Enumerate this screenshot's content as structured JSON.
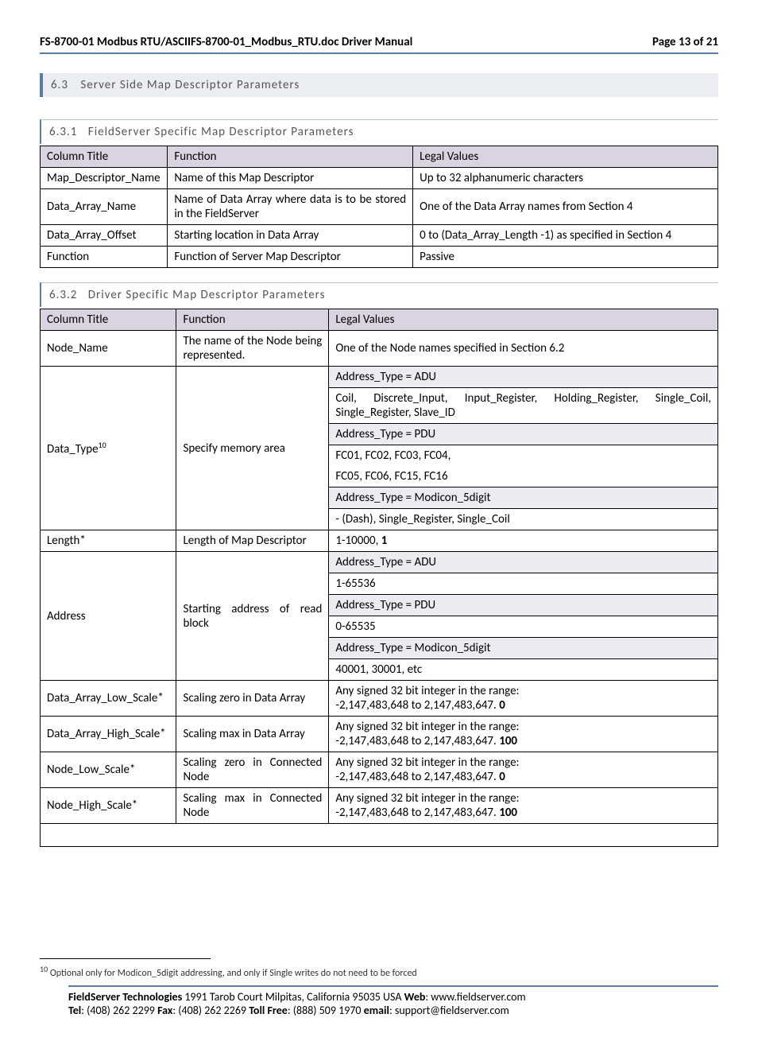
{
  "header": {
    "left": "FS-8700-01 Modbus RTU/ASCIIFS-8700-01_Modbus_RTU.doc Driver Manual",
    "right": "Page 13 of 21"
  },
  "section_6_3": {
    "num": "6.3",
    "title": "Server Side Map Descriptor Parameters"
  },
  "section_6_3_1": {
    "num": "6.3.1",
    "title": "FieldServer Specific Map Descriptor Parameters"
  },
  "table1_headers": {
    "c1": "Column Title",
    "c2": "Function",
    "c3": "Legal Values"
  },
  "table1": [
    {
      "c1": "Map_Descriptor_Name",
      "c2": "Name of this Map Descriptor",
      "c3": "Up to 32 alphanumeric characters"
    },
    {
      "c1": "Data_Array_Name",
      "c2": "Name of Data Array where data is to be stored in the FieldServer",
      "c3": "One of the Data Array names from Section 4"
    },
    {
      "c1": "Data_Array_Offset",
      "c2": "Starting location in Data Array",
      "c3": "0 to (Data_Array_Length -1) as specified in Section 4"
    },
    {
      "c1": "Function",
      "c2": "Function of Server Map Descriptor",
      "c3": "Passive"
    }
  ],
  "section_6_3_2": {
    "num": "6.3.2",
    "title": "Driver Specific Map Descriptor Parameters"
  },
  "table2_headers": {
    "c1": "Column Title",
    "c2": "Function",
    "c3": "Legal Values"
  },
  "table2": {
    "node_name": {
      "c1": "Node_Name",
      "c2": "The name of the Node being represented.",
      "c3": "One of the Node names specified in Section 6.2"
    },
    "data_type": {
      "c1_prefix": "Data_Type",
      "c1_sup": "10",
      "c2": "Specify memory area",
      "sub_adu_hdr": "Address_Type = ADU",
      "sub_adu_val": "Coil, Discrete_Input, Input_Register, Holding_Register, Single_Coil, Single_Register, Slave_ID",
      "sub_pdu_hdr": "Address_Type = PDU",
      "sub_pdu_val1": "FC01, FC02, FC03, FC04,",
      "sub_pdu_val2": "FC05, FC06, FC15, FC16",
      "sub_mod_hdr": "Address_Type = Modicon_5digit",
      "sub_mod_val": "- (Dash), Single_Register, Single_Coil"
    },
    "length": {
      "c1": "Length*",
      "c2": "Length of Map Descriptor",
      "c3_pre": "1-10000, ",
      "c3_bold": "1"
    },
    "address": {
      "c1": "Address",
      "c2": "Starting address of read block",
      "sub_adu_hdr": "Address_Type = ADU",
      "sub_adu_val": "1-65536",
      "sub_pdu_hdr": "Address_Type = PDU",
      "sub_pdu_val": "0-65535",
      "sub_mod_hdr": "Address_Type = Modicon_5digit",
      "sub_mod_val": "40001, 30001, etc"
    },
    "da_low": {
      "c1": "Data_Array_Low_Scale*",
      "c2": "Scaling zero in Data Array",
      "c3_line1": "Any signed 32 bit integer in the range:",
      "c3_pre": "-2,147,483,648 to 2,147,483,647.   ",
      "c3_bold": "0"
    },
    "da_high": {
      "c1": "Data_Array_High_Scale*",
      "c2": "Scaling max in Data Array",
      "c3_line1": "Any signed 32 bit integer in the range:",
      "c3_pre": "-2,147,483,648 to 2,147,483,647.   ",
      "c3_bold": "100"
    },
    "n_low": {
      "c1": "Node_Low_Scale*",
      "c2": "Scaling zero in Connected Node",
      "c3_line1": "Any signed 32 bit integer in the range:",
      "c3_pre": "-2,147,483,648 to 2,147,483,647. ",
      "c3_bold": "0"
    },
    "n_high": {
      "c1": "Node_High_Scale*",
      "c2": "Scaling max in Connected Node",
      "c3_line1": "Any signed 32 bit integer in the range:",
      "c3_pre": "-2,147,483,648 to 2,147,483,647.   ",
      "c3_bold": "100"
    }
  },
  "footnote": {
    "sup": "10",
    "text": " Optional only for Modicon_5digit addressing, and only if Single writes do not need to be forced"
  },
  "footer": {
    "company": "FieldServer Technologies",
    "address": " 1991 Tarob Court Milpitas, California 95035 USA   ",
    "web_label": "Web",
    "web": ": www.fieldserver.com",
    "tel_label": "Tel",
    "tel": ": (408) 262 2299   ",
    "fax_label": "Fax",
    "fax": ": (408) 262 2269   ",
    "tf_label": "Toll Free",
    "tf": ": (888) 509 1970   ",
    "em_label": "email",
    "em": ": support@fieldserver.com"
  }
}
